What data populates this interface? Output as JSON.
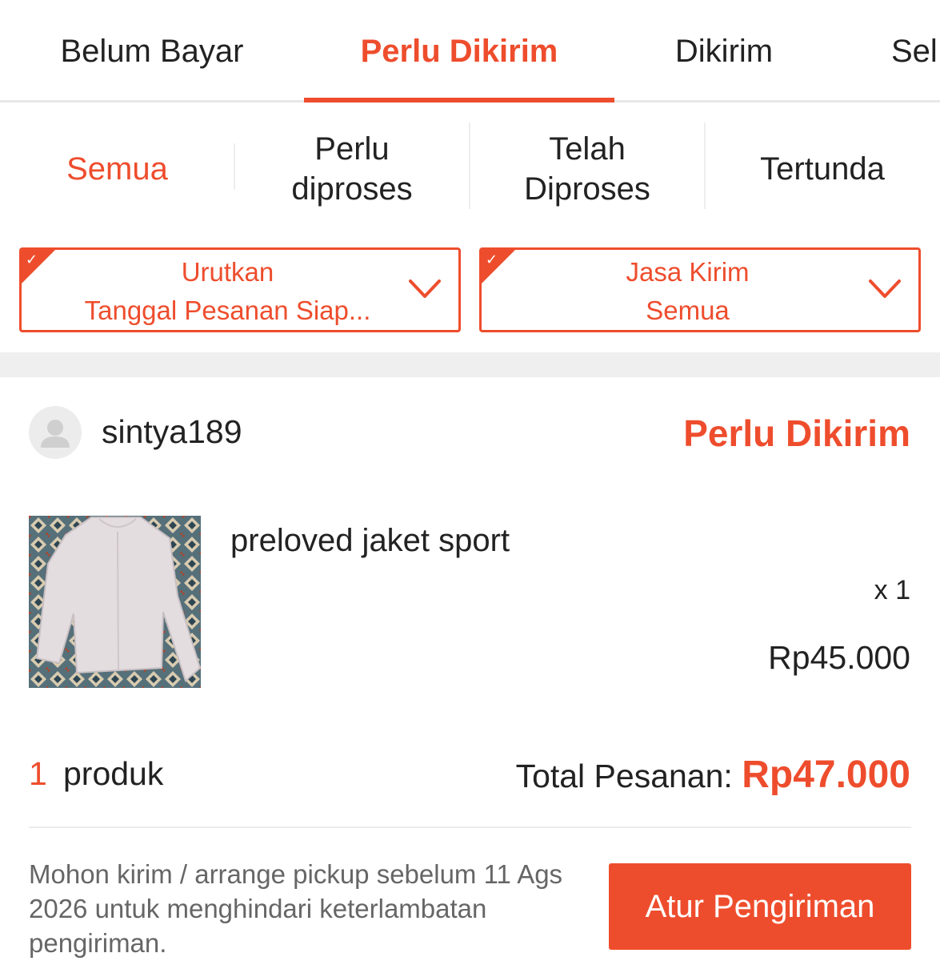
{
  "top_tabs": [
    {
      "label": "Belum Bayar"
    },
    {
      "label": "Perlu Dikirim",
      "active": true
    },
    {
      "label": "Dikirim"
    },
    {
      "label": "Sel"
    }
  ],
  "sub_tabs": [
    {
      "line1": "Semua",
      "line2": "",
      "active": true
    },
    {
      "line1": "Perlu",
      "line2": "diproses"
    },
    {
      "line1": "Telah",
      "line2": "Diproses"
    },
    {
      "line1": "Tertunda",
      "line2": ""
    }
  ],
  "filters": {
    "sort": {
      "title": "Urutkan",
      "value": "Tanggal Pesanan Siap..."
    },
    "courier": {
      "title": "Jasa Kirim",
      "value": "Semua"
    }
  },
  "order": {
    "buyer": "sintya189",
    "status": "Perlu Dikirim",
    "product": {
      "name": "preloved jaket sport",
      "qty": "x 1",
      "price": "Rp45.000"
    },
    "product_count": "1",
    "product_count_label": "produk",
    "total_label": "Total Pesanan: ",
    "total_value": "Rp47.000",
    "notice": "Mohon kirim / arrange pickup sebelum 11 Ags 2026 untuk menghindari keterlambatan pengiriman.",
    "action_label": "Atur Pengiriman"
  },
  "colors": {
    "accent": "#ee4d2d",
    "text": "#222222",
    "muted": "#666666",
    "divider": "#ececec"
  },
  "icons": [
    "check-icon",
    "chevron-down-icon",
    "user-avatar-icon"
  ]
}
